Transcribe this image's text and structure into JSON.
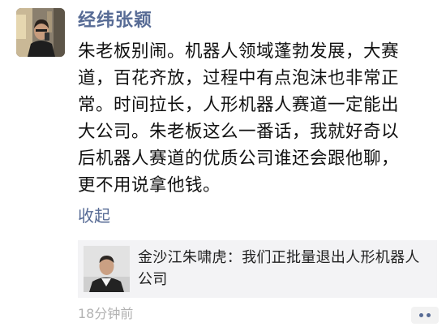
{
  "post": {
    "author": "经纬张颖",
    "body": "朱老板别闹。机器人领域蓬勃发展，大赛\n道，百花齐放，过程中有点泡沫也非常正\n常。时间拉长，人形机器人赛道一定能出\n大公司。朱老板这么一番话，我就好奇以\n后机器人赛道的优质公司谁还会跟他聊，\n更不用说拿他钱。",
    "collapse_label": "收起",
    "time": "18分钟前"
  },
  "shared_article": {
    "title": "金沙江朱啸虎：我们正批量退出人形机器人公司"
  },
  "icons": {
    "more": "more-dots-icon"
  },
  "colors": {
    "name_link": "#576b95",
    "card_bg": "#f3f3f5",
    "time_text": "#b2b2b2"
  }
}
